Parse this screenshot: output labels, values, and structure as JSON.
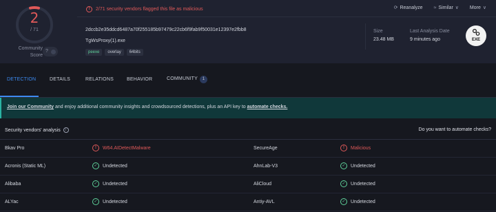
{
  "summary": {
    "score": "2",
    "score_total": "/ 71",
    "community_label": "Community\nScore",
    "community_value": "?",
    "alert_text": "2/71 security vendors flagged this file as malicious",
    "actions": [
      {
        "label": "Reanalyze",
        "icon": "reanalyze-icon",
        "glyph": "⟳"
      },
      {
        "label": "Similar",
        "icon": "similar-icon",
        "glyph": "≈",
        "chevron": "∨"
      },
      {
        "label": "More",
        "icon": "more-icon",
        "chevron": "∨"
      }
    ],
    "file_hash": "2dccb2e35ddcd6487a70f255185b97479c22cb6f9fab9f50031e12397e2fbb8",
    "file_name": "TgWsProxy(1).exe",
    "tags": [
      "peexe",
      "overlay",
      "64bits"
    ],
    "size_label": "Size",
    "size_value": "23.48 MB",
    "last_analysis_label": "Last Analysis Date",
    "last_analysis_value": "9 minutes ago",
    "file_type": "EXE",
    "score_color": "#e05959"
  },
  "tabs": [
    {
      "label": "DETECTION",
      "active": true
    },
    {
      "label": "DETAILS"
    },
    {
      "label": "RELATIONS"
    },
    {
      "label": "BEHAVIOR"
    },
    {
      "label": "COMMUNITY",
      "count": "1"
    }
  ],
  "banner": {
    "link1": "Join our Community",
    "text": " and enjoy additional community insights and crowdsourced detections, plus an API key to ",
    "link2": "automate checks."
  },
  "vendors": {
    "title": "Security vendors' analysis",
    "cta": "Do you want to automate checks?",
    "rows": [
      {
        "left_name": "Bkav Pro",
        "left_result": "W64.AIDetectMalware",
        "left_status": "bad",
        "right_name": "SecureAge",
        "right_result": "Malicious",
        "right_status": "bad"
      },
      {
        "left_name": "Acronis (Static ML)",
        "left_result": "Undetected",
        "left_status": "good",
        "right_name": "AhnLab-V3",
        "right_result": "Undetected",
        "right_status": "good"
      },
      {
        "left_name": "Alibaba",
        "left_result": "Undetected",
        "left_status": "good",
        "right_name": "AliCloud",
        "right_result": "Undetected",
        "right_status": "good"
      },
      {
        "left_name": "ALYac",
        "left_result": "Undetected",
        "left_status": "good",
        "right_name": "Antiy-AVL",
        "right_result": "Undetected",
        "right_status": "good"
      }
    ]
  },
  "colors": {
    "malicious": "#e05959",
    "clean": "#5fd39b",
    "accent": "#3d8bf2"
  }
}
